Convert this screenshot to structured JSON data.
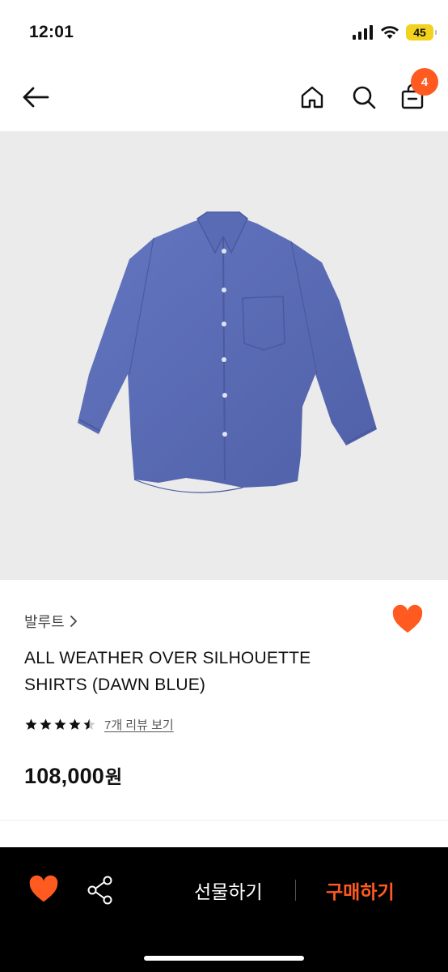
{
  "status_bar": {
    "time": "12:01",
    "battery": "45"
  },
  "header": {
    "cart_count": "4"
  },
  "product": {
    "brand": "발루트",
    "title_line1": "ALL WEATHER OVER SILHOUETTE",
    "title_line2": "SHIRTS (DAWN BLUE)",
    "rating": 4.5,
    "review_link": "7개 리뷰 보기",
    "price": "108,000",
    "price_unit": "원",
    "image_color": "#5b6db6"
  },
  "bottom_bar": {
    "gift_label": "선물하기",
    "buy_label": "구매하기"
  },
  "colors": {
    "accent": "#ff5a1f",
    "background": "#ffffff",
    "image_bg": "#ebebeb"
  }
}
